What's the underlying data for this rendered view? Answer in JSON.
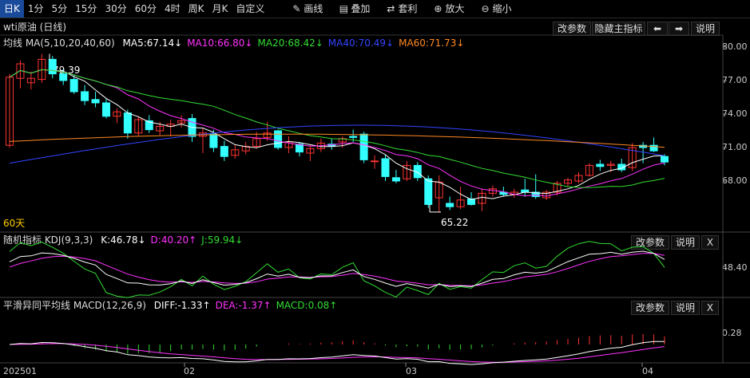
{
  "toolbar": {
    "items": [
      {
        "label": "日K",
        "active": true
      },
      {
        "label": "1分"
      },
      {
        "label": "5分"
      },
      {
        "label": "15分"
      },
      {
        "label": "30分"
      },
      {
        "label": "60分"
      },
      {
        "label": "4时"
      },
      {
        "label": "周K"
      },
      {
        "label": "月K"
      },
      {
        "label": "自定义"
      }
    ],
    "tools": [
      {
        "label": "画线",
        "icon": "pencil-icon",
        "glyph": "✎"
      },
      {
        "label": "叠加",
        "icon": "overlay-icon",
        "glyph": "▤"
      },
      {
        "label": "套利",
        "icon": "arbitrage-icon",
        "glyph": "⇄"
      },
      {
        "label": "放大",
        "icon": "zoom-in-icon",
        "glyph": "⊕"
      },
      {
        "label": "缩小",
        "icon": "zoom-out-icon",
        "glyph": "⊖"
      }
    ]
  },
  "main": {
    "title": "wti原油 (日线)",
    "buttons": {
      "params": "改参数",
      "hide": "隐藏主指标",
      "prev": "⬅",
      "next": "➡",
      "help": "说明"
    },
    "ma_label": "均线 MA(5,10,20,40,60)",
    "ma_values": [
      {
        "text": "MA5:67.14↓",
        "color": "#ffffff"
      },
      {
        "text": "MA10:66.80↓",
        "color": "#ff33ff"
      },
      {
        "text": "MA20:68.42↓",
        "color": "#33dd33"
      },
      {
        "text": "MA40:70.49↓",
        "color": "#3344ff"
      },
      {
        "text": "MA60:71.73↓",
        "color": "#ff8822"
      }
    ],
    "y_ticks": [
      "80.00",
      "77.00",
      "74.00",
      "71.00",
      "68.00"
    ],
    "high_annotation": "79.39",
    "low_annotation": "65.22",
    "period_label": "60天"
  },
  "kdj": {
    "label": "随机指标 KDJ(9,3,3)",
    "values": [
      {
        "text": "K:46.78↓",
        "color": "#ffffff"
      },
      {
        "text": "D:40.20↑",
        "color": "#ff33ff"
      },
      {
        "text": "J:59.94↓",
        "color": "#33dd33"
      }
    ],
    "y_tick": "48.40",
    "buttons": {
      "params": "改参数",
      "help": "说明",
      "close": "X"
    }
  },
  "macd": {
    "label": "平滑异同平均线 MACD(12,26,9)",
    "values": [
      {
        "text": "DIFF:-1.33↑",
        "color": "#ffffff"
      },
      {
        "text": "DEA:-1.37↑",
        "color": "#ff33ff"
      },
      {
        "text": "MACD:0.08↑",
        "color": "#33dd33"
      }
    ],
    "y_tick": "0.28",
    "buttons": {
      "params": "改参数",
      "help": "说明",
      "close": "X"
    }
  },
  "dates": [
    "202501",
    "02",
    "03",
    "04"
  ],
  "colors": {
    "up": "#ff3333",
    "down": "#33ffff",
    "ma5": "#ffffff",
    "ma10": "#ff33ff",
    "ma20": "#33dd33",
    "ma40": "#3344ff",
    "ma60": "#ff8822"
  },
  "chart_data": {
    "type": "candlestick",
    "title": "wti原油 (日线)",
    "ylim": [
      63.5,
      80.5
    ],
    "candles": [
      {
        "o": 71.2,
        "h": 77.6,
        "l": 71.0,
        "c": 77.3
      },
      {
        "o": 77.2,
        "h": 78.8,
        "l": 76.3,
        "c": 78.5
      },
      {
        "o": 76.8,
        "h": 77.8,
        "l": 76.2,
        "c": 77.2
      },
      {
        "o": 77.1,
        "h": 79.39,
        "l": 76.8,
        "c": 78.9
      },
      {
        "o": 78.9,
        "h": 79.2,
        "l": 77.2,
        "c": 77.6
      },
      {
        "o": 77.6,
        "h": 78.0,
        "l": 76.6,
        "c": 77.0
      },
      {
        "o": 77.1,
        "h": 77.5,
        "l": 75.8,
        "c": 76.0
      },
      {
        "o": 76.0,
        "h": 76.6,
        "l": 74.8,
        "c": 75.2
      },
      {
        "o": 75.3,
        "h": 76.0,
        "l": 74.6,
        "c": 75.0
      },
      {
        "o": 75.0,
        "h": 75.4,
        "l": 73.6,
        "c": 73.8
      },
      {
        "o": 73.8,
        "h": 74.5,
        "l": 73.2,
        "c": 74.2
      },
      {
        "o": 74.1,
        "h": 74.4,
        "l": 71.8,
        "c": 72.3
      },
      {
        "o": 72.3,
        "h": 73.8,
        "l": 72.0,
        "c": 73.5
      },
      {
        "o": 73.4,
        "h": 73.9,
        "l": 72.3,
        "c": 72.6
      },
      {
        "o": 72.5,
        "h": 73.3,
        "l": 72.1,
        "c": 72.9
      },
      {
        "o": 72.9,
        "h": 73.5,
        "l": 72.0,
        "c": 73.1
      },
      {
        "o": 73.2,
        "h": 73.9,
        "l": 72.8,
        "c": 73.4
      },
      {
        "o": 73.6,
        "h": 74.0,
        "l": 71.5,
        "c": 72.0
      },
      {
        "o": 72.0,
        "h": 72.8,
        "l": 70.5,
        "c": 72.3
      },
      {
        "o": 72.2,
        "h": 72.6,
        "l": 70.6,
        "c": 71.0
      },
      {
        "o": 71.1,
        "h": 71.6,
        "l": 69.8,
        "c": 70.2
      },
      {
        "o": 70.3,
        "h": 71.2,
        "l": 70.0,
        "c": 70.8
      },
      {
        "o": 70.7,
        "h": 71.5,
        "l": 70.4,
        "c": 71.1
      },
      {
        "o": 71.1,
        "h": 72.4,
        "l": 70.9,
        "c": 71.8
      },
      {
        "o": 71.9,
        "h": 73.3,
        "l": 71.6,
        "c": 72.3
      },
      {
        "o": 72.5,
        "h": 72.6,
        "l": 70.8,
        "c": 71.0
      },
      {
        "o": 71.0,
        "h": 72.0,
        "l": 70.5,
        "c": 71.5
      },
      {
        "o": 71.3,
        "h": 71.5,
        "l": 70.2,
        "c": 70.6
      },
      {
        "o": 70.5,
        "h": 71.2,
        "l": 69.8,
        "c": 70.9
      },
      {
        "o": 70.9,
        "h": 71.8,
        "l": 70.6,
        "c": 71.4
      },
      {
        "o": 71.3,
        "h": 71.8,
        "l": 70.8,
        "c": 71.1
      },
      {
        "o": 71.5,
        "h": 72.0,
        "l": 71.0,
        "c": 71.8
      },
      {
        "o": 72.0,
        "h": 72.6,
        "l": 71.5,
        "c": 71.9
      },
      {
        "o": 72.2,
        "h": 72.4,
        "l": 69.6,
        "c": 69.9
      },
      {
        "o": 69.8,
        "h": 70.3,
        "l": 69.1,
        "c": 69.8
      },
      {
        "o": 70.0,
        "h": 70.4,
        "l": 68.0,
        "c": 68.4
      },
      {
        "o": 68.3,
        "h": 69.0,
        "l": 67.8,
        "c": 68.0
      },
      {
        "o": 68.2,
        "h": 69.8,
        "l": 68.0,
        "c": 69.4
      },
      {
        "o": 69.4,
        "h": 69.7,
        "l": 68.0,
        "c": 68.3
      },
      {
        "o": 68.2,
        "h": 68.5,
        "l": 65.6,
        "c": 65.9
      },
      {
        "o": 66.5,
        "h": 68.5,
        "l": 65.2,
        "c": 67.9
      },
      {
        "o": 66.0,
        "h": 66.6,
        "l": 65.4,
        "c": 65.7
      },
      {
        "o": 65.7,
        "h": 67.5,
        "l": 65.5,
        "c": 66.3
      },
      {
        "o": 66.4,
        "h": 67.0,
        "l": 65.8,
        "c": 65.9
      },
      {
        "o": 66.0,
        "h": 67.3,
        "l": 65.3,
        "c": 66.9
      },
      {
        "o": 66.9,
        "h": 67.6,
        "l": 66.6,
        "c": 67.3
      },
      {
        "o": 67.0,
        "h": 67.5,
        "l": 66.6,
        "c": 66.8
      },
      {
        "o": 66.8,
        "h": 67.3,
        "l": 66.5,
        "c": 67.0
      },
      {
        "o": 67.2,
        "h": 68.2,
        "l": 66.6,
        "c": 67.0
      },
      {
        "o": 67.0,
        "h": 68.6,
        "l": 66.4,
        "c": 66.6
      },
      {
        "o": 66.5,
        "h": 67.2,
        "l": 66.3,
        "c": 67.0
      },
      {
        "o": 67.0,
        "h": 68.0,
        "l": 66.7,
        "c": 67.8
      },
      {
        "o": 67.8,
        "h": 68.3,
        "l": 67.5,
        "c": 68.1
      },
      {
        "o": 68.0,
        "h": 68.8,
        "l": 67.8,
        "c": 68.5
      },
      {
        "o": 68.5,
        "h": 69.6,
        "l": 68.4,
        "c": 69.4
      },
      {
        "o": 69.5,
        "h": 69.9,
        "l": 68.9,
        "c": 69.3
      },
      {
        "o": 69.4,
        "h": 69.8,
        "l": 68.8,
        "c": 69.5
      },
      {
        "o": 69.5,
        "h": 70.0,
        "l": 68.8,
        "c": 69.0
      },
      {
        "o": 69.2,
        "h": 71.4,
        "l": 68.9,
        "c": 71.0
      },
      {
        "o": 71.2,
        "h": 71.5,
        "l": 69.6,
        "c": 71.0
      },
      {
        "o": 71.2,
        "h": 71.9,
        "l": 70.6,
        "c": 70.7
      },
      {
        "o": 70.2,
        "h": 70.4,
        "l": 69.4,
        "c": 69.7
      }
    ]
  }
}
